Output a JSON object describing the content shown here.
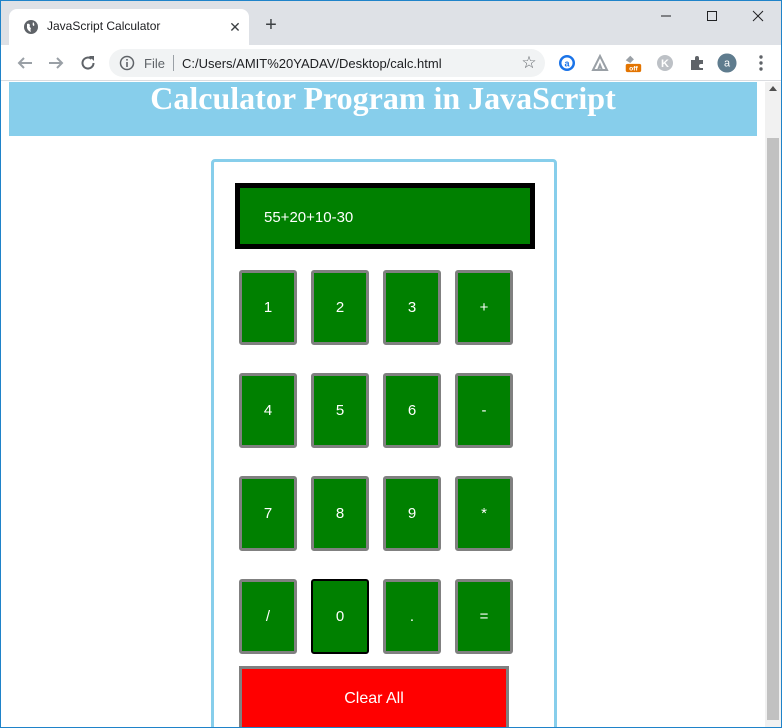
{
  "browser": {
    "tab_title": "JavaScript Calculator",
    "new_tab_symbol": "+",
    "close_symbol": "✕",
    "omnibox_scheme": "File",
    "url": "C:/Users/AMIT%20YADAV/Desktop/calc.html",
    "ext_badge": "off",
    "profile_initial": "a"
  },
  "page": {
    "heading": "Calculator Program in JavaScript"
  },
  "calculator": {
    "display_value": "55+20+10-30",
    "keys": [
      "1",
      "2",
      "3",
      "+",
      "4",
      "5",
      "6",
      "-",
      "7",
      "8",
      "9",
      "*",
      "/",
      "0",
      ".",
      "="
    ],
    "clear_label": "Clear All",
    "colors": {
      "key_bg": "#008000",
      "key_border": "#808080",
      "clear_bg": "#ff0000",
      "banner_bg": "#87ceeb"
    }
  }
}
